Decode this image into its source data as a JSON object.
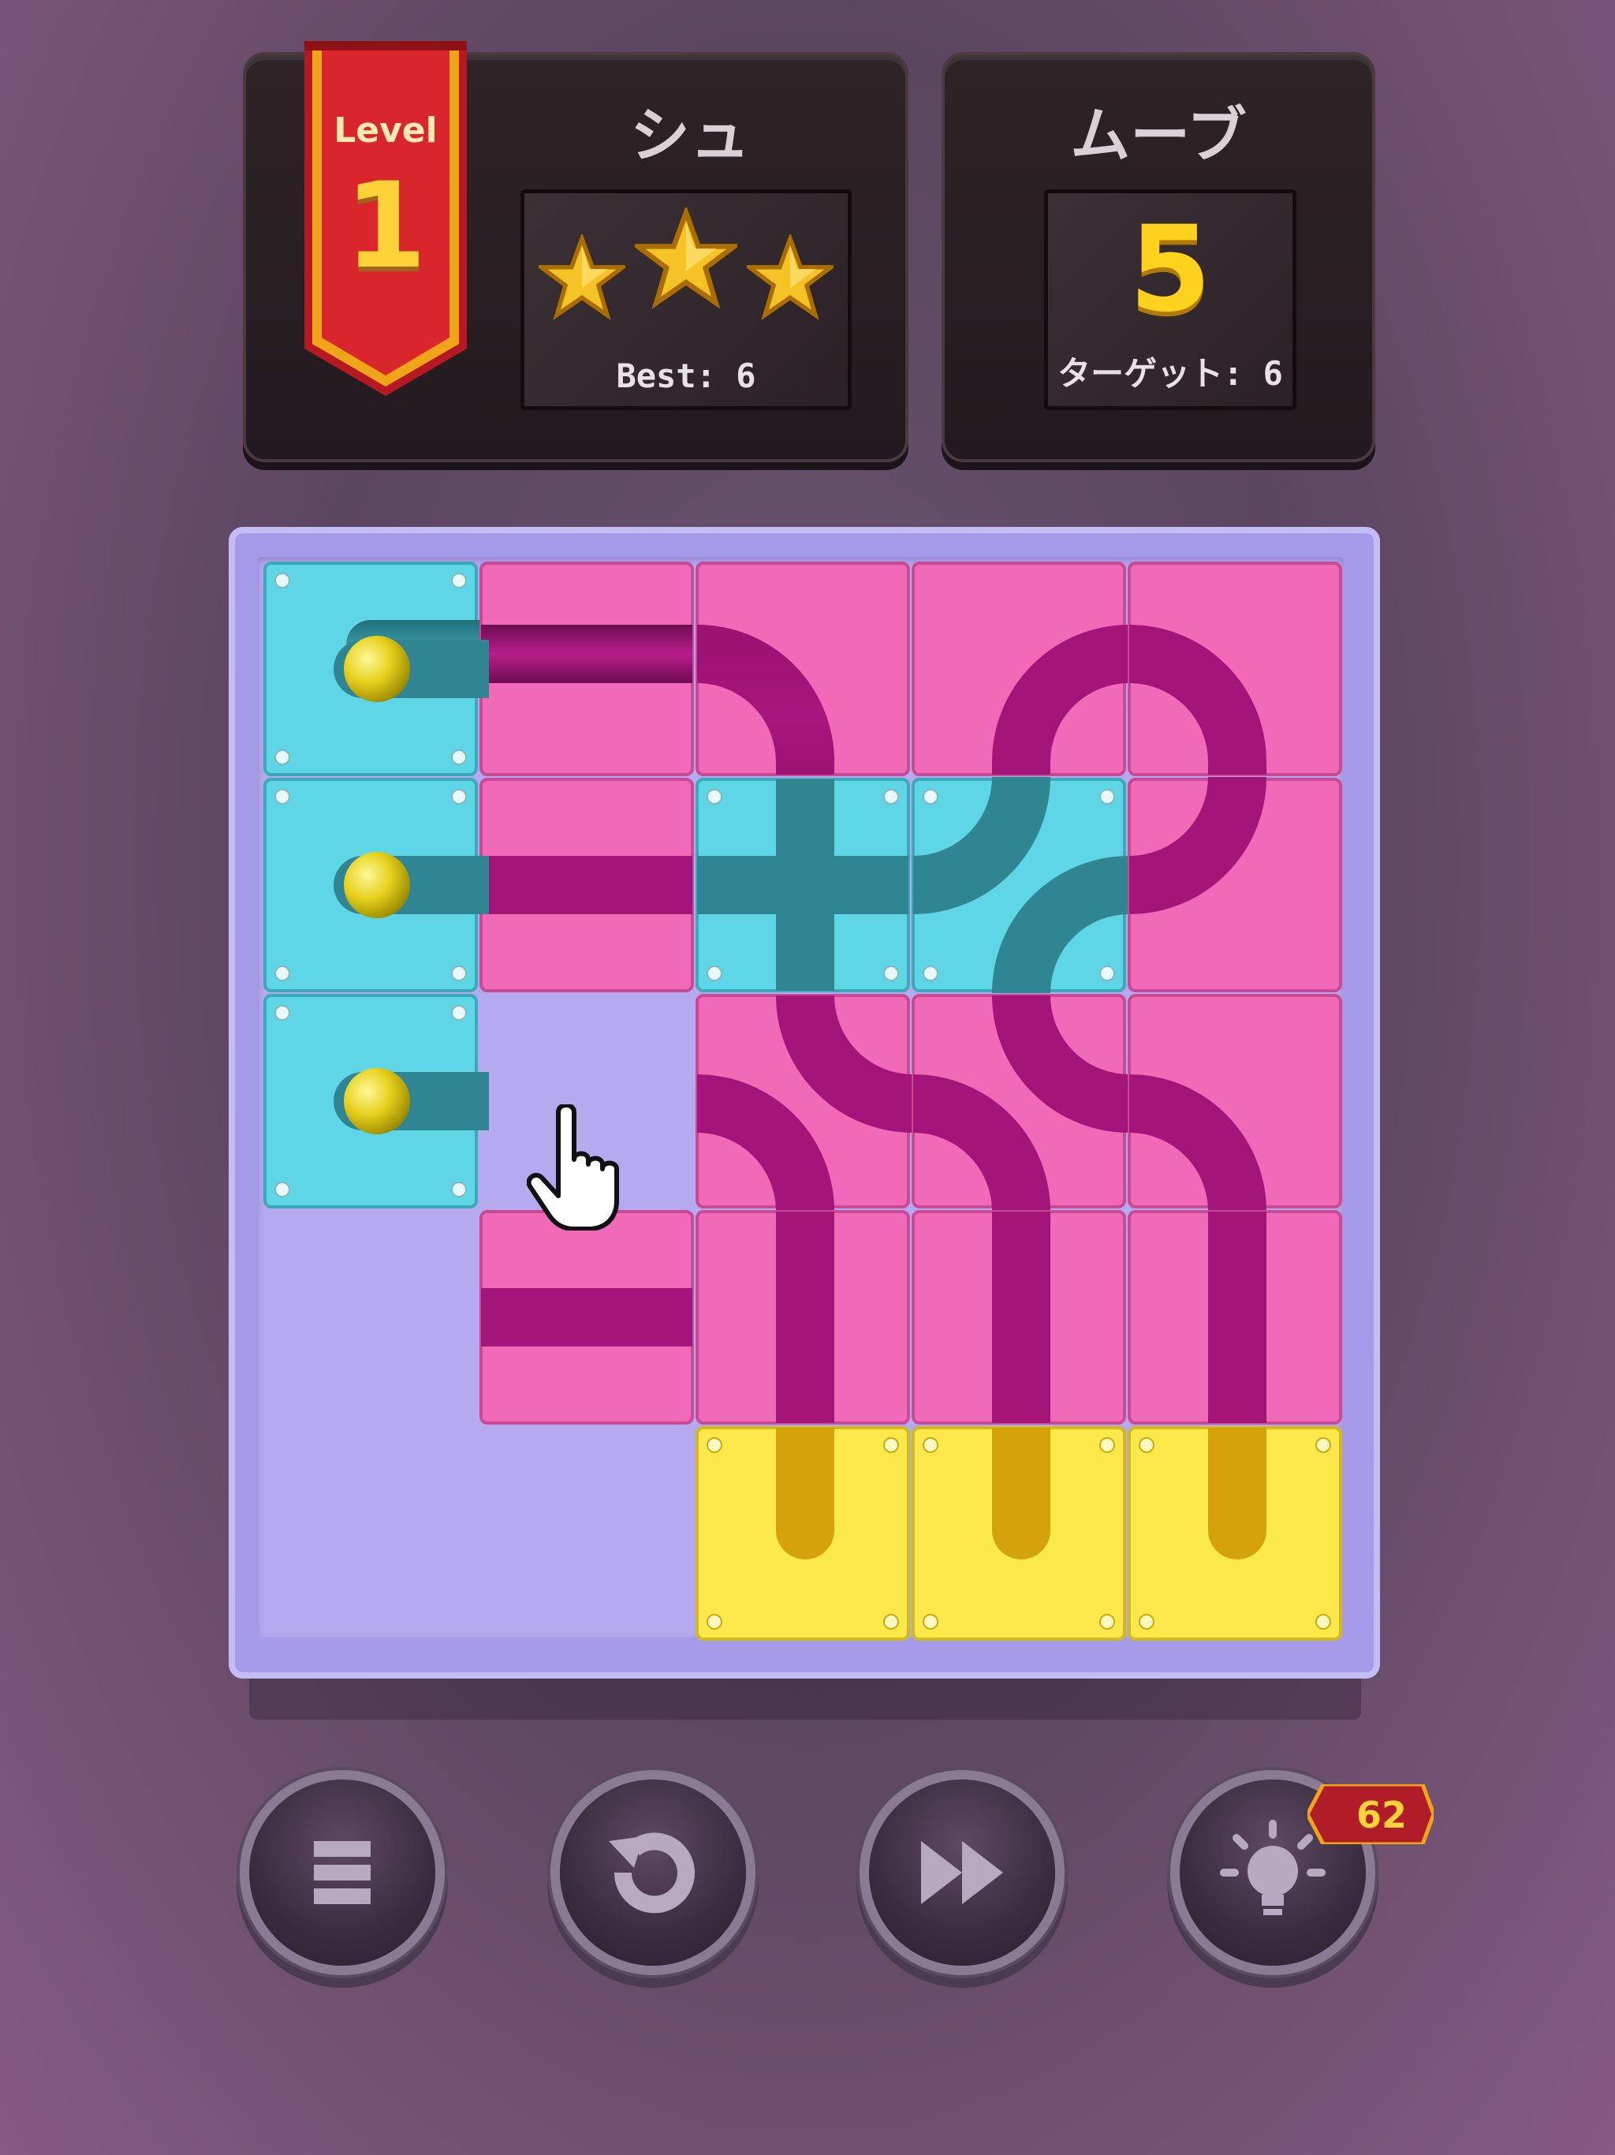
{
  "level": {
    "label": "Level",
    "number": "1"
  },
  "shoot_panel": {
    "title": "シュ",
    "best_label": "Best: 6",
    "stars_earned": 3
  },
  "moves_panel": {
    "title": "ムーブ",
    "moves": "5",
    "target_label": "ターゲット: 6"
  },
  "hint": {
    "count": "62"
  },
  "icons": {
    "menu": "menu-icon",
    "restart": "restart-icon",
    "skip": "fast-forward-icon",
    "hint": "lightbulb-icon"
  },
  "colors": {
    "pink_tile": "#f06ab8",
    "cyan_tile": "#5fd6e6",
    "yellow_tile": "#fbe84a",
    "pipe_magenta": "#a4157a",
    "board": "#a69be8"
  }
}
